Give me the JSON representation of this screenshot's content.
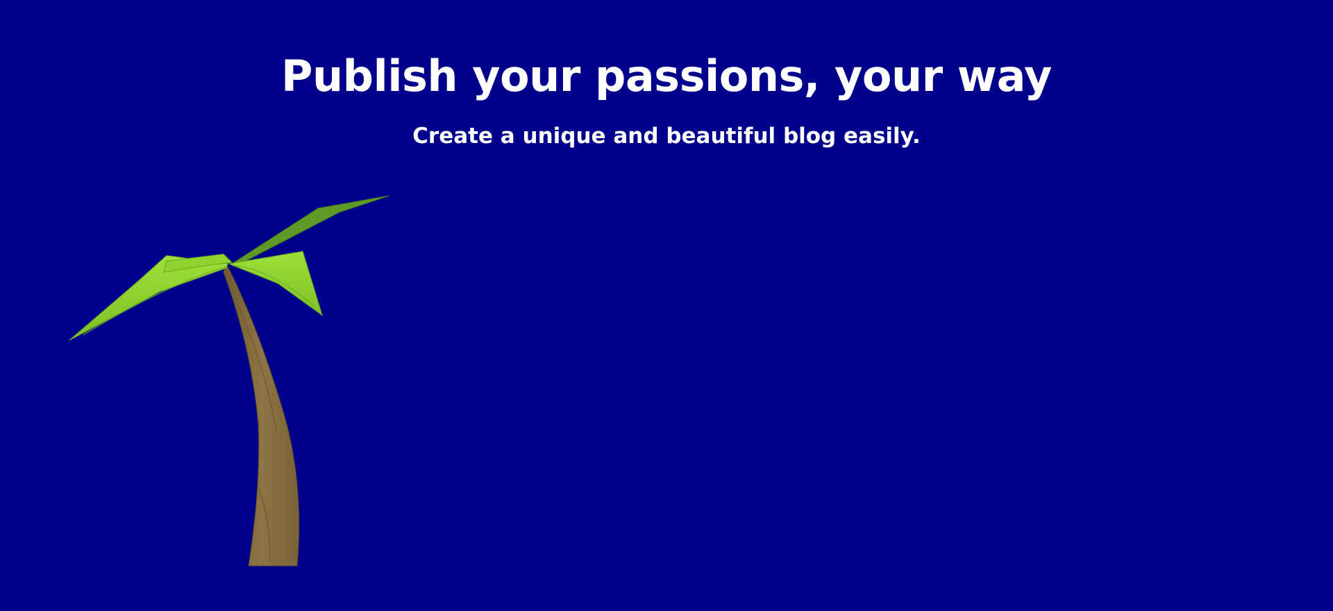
{
  "hero": {
    "title": "Publish your passions, your way",
    "subtitle": "Create a unique and beautiful blog easily."
  },
  "illustration": {
    "icon": "palm-tree-icon"
  },
  "colors": {
    "background": "#00008b",
    "text": "#ffffff",
    "leaf_light": "#8fd32e",
    "leaf_dark": "#5e9a26",
    "trunk": "#8a7140"
  }
}
